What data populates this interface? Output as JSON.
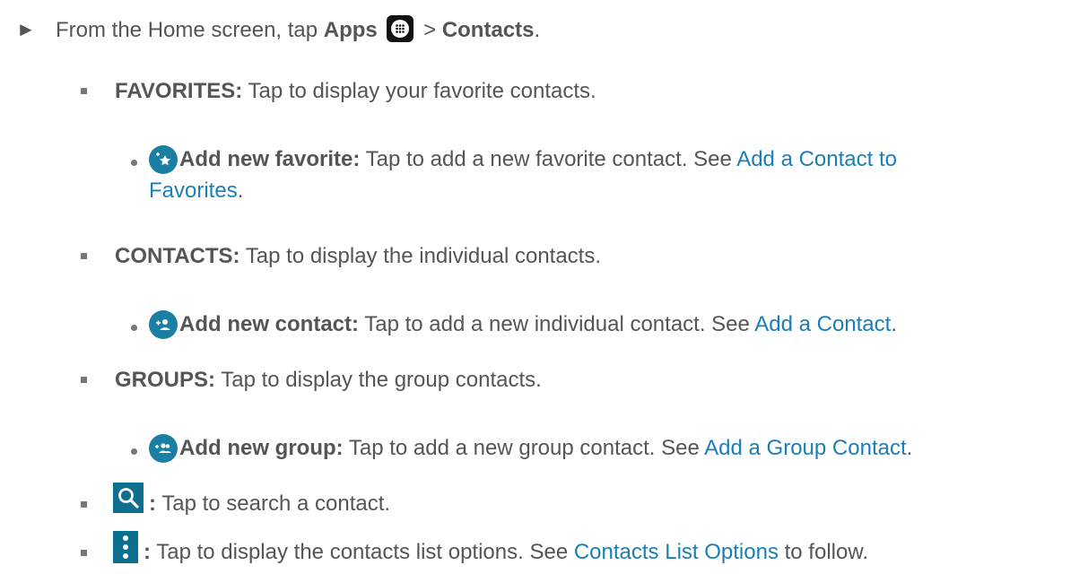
{
  "intro": {
    "arrow": "►",
    "prefix": "From the Home screen, tap ",
    "apps": "Apps",
    "gt": " > ",
    "contacts": "Contacts",
    "end": "."
  },
  "items": {
    "favorites": {
      "label": "FAVORITES:",
      "text": " Tap to display your favorite contacts."
    },
    "add_favorite": {
      "label": "Add new favorite:",
      "text": " Tap to add a new favorite contact. See ",
      "link1": "Add a Contact to",
      "link2": "Favorites",
      "end": "."
    },
    "contacts": {
      "label": "CONTACTS:",
      "text": " Tap to display the individual contacts."
    },
    "add_contact": {
      "label": "Add new contact:",
      "text": " Tap to add a new individual contact. See ",
      "link": "Add a Contact",
      "end": "."
    },
    "groups": {
      "label": "GROUPS:",
      "text": " Tap to display the group contacts."
    },
    "add_group": {
      "label": "Add new group:",
      "text": " Tap to add a new group contact. See ",
      "link": "Add a Group Contact",
      "end": "."
    },
    "search": {
      "label": ":",
      "text": " Tap to search a contact."
    },
    "menu": {
      "label": ":",
      "text": " Tap to display the contacts list options. See ",
      "link": "Contacts List Options",
      "end": " to follow."
    }
  },
  "icons": {
    "apps": "apps-grid-icon",
    "add_favorite": "add-favorite-icon",
    "add_contact": "add-contact-icon",
    "add_group": "add-group-icon",
    "search": "search-icon",
    "menu": "more-vert-icon"
  },
  "colors": {
    "text": "#555555",
    "link": "#1a7fb5",
    "icon": "#1a7fa3"
  }
}
